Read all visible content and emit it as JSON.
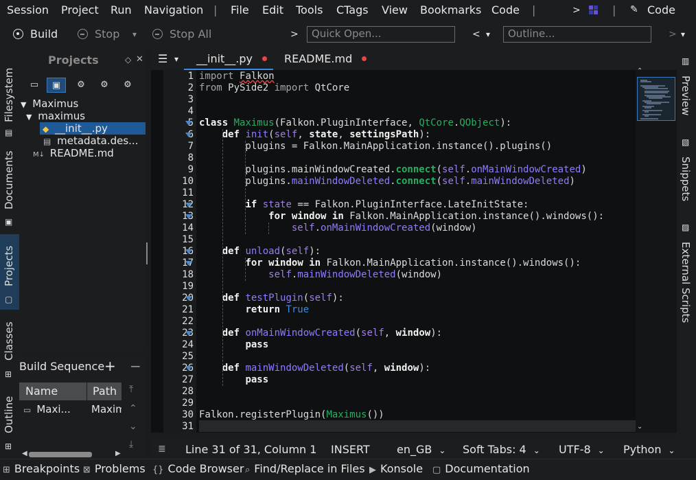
{
  "menu": {
    "items": [
      "Session",
      "Project",
      "Run",
      "Navigation",
      "File",
      "Edit",
      "Tools",
      "CTags",
      "View",
      "Bookmarks",
      "Code"
    ],
    "right_label": "Code"
  },
  "toolbar": {
    "build": "Build",
    "stop": "Stop",
    "stop_all": "Stop All",
    "quick_open_placeholder": "Quick Open...",
    "outline_placeholder": "Outline..."
  },
  "left_tabs": [
    "Filesystem",
    "Documents",
    "Projects",
    "Classes",
    "Outline"
  ],
  "right_tabs": [
    "Preview",
    "Snippets",
    "External Scripts"
  ],
  "projects": {
    "title": "Projects",
    "tree": [
      {
        "label": "Maximus",
        "level": 0
      },
      {
        "label": "maximus",
        "level": 1
      },
      {
        "label": "__init__.py",
        "level": 2
      },
      {
        "label": "metadata.des...",
        "level": 2
      },
      {
        "label": "README.md",
        "level": 1
      }
    ]
  },
  "build_sequence": {
    "title": "Build Sequence",
    "columns": [
      "Name",
      "Path"
    ],
    "rows": [
      {
        "name": "Maxi...",
        "path": "Maxim"
      }
    ]
  },
  "tabs": [
    {
      "label": "__init__.py",
      "modified": true
    },
    {
      "label": "README.md",
      "modified": true
    }
  ],
  "code_lines": [
    "import Falkon",
    "from PySide2 import QtCore",
    "",
    "",
    "class Maximus(Falkon.PluginInterface, QtCore.QObject):",
    "    def init(self, state, settingsPath):",
    "        plugins = Falkon.MainApplication.instance().plugins()",
    "",
    "        plugins.mainWindowCreated.connect(self.onMainWindowCreated)",
    "        plugins.mainWindowDeleted.connect(self.mainWindowDeleted)",
    "",
    "        if state == Falkon.PluginInterface.LateInitState:",
    "            for window in Falkon.MainApplication.instance().windows():",
    "                self.onMainWindowCreated(window)",
    "",
    "    def unload(self):",
    "        for window in Falkon.MainApplication.instance().windows():",
    "            self.mainWindowDeleted(window)",
    "",
    "    def testPlugin(self):",
    "        return True",
    "",
    "    def onMainWindowCreated(self, window):",
    "        pass",
    "",
    "    def mainWindowDeleted(self, window):",
    "        pass",
    "",
    "",
    "Falkon.registerPlugin(Maximus())",
    ""
  ],
  "status": {
    "position": "Line 31 of 31, Column 1",
    "mode": "INSERT",
    "dictionary": "en_GB",
    "indent": "Soft Tabs: 4",
    "encoding": "UTF-8",
    "language": "Python"
  },
  "bottom_tools": [
    "Breakpoints",
    "Problems",
    "Code Browser",
    "Find/Replace in Files",
    "Konsole",
    "Documentation"
  ]
}
